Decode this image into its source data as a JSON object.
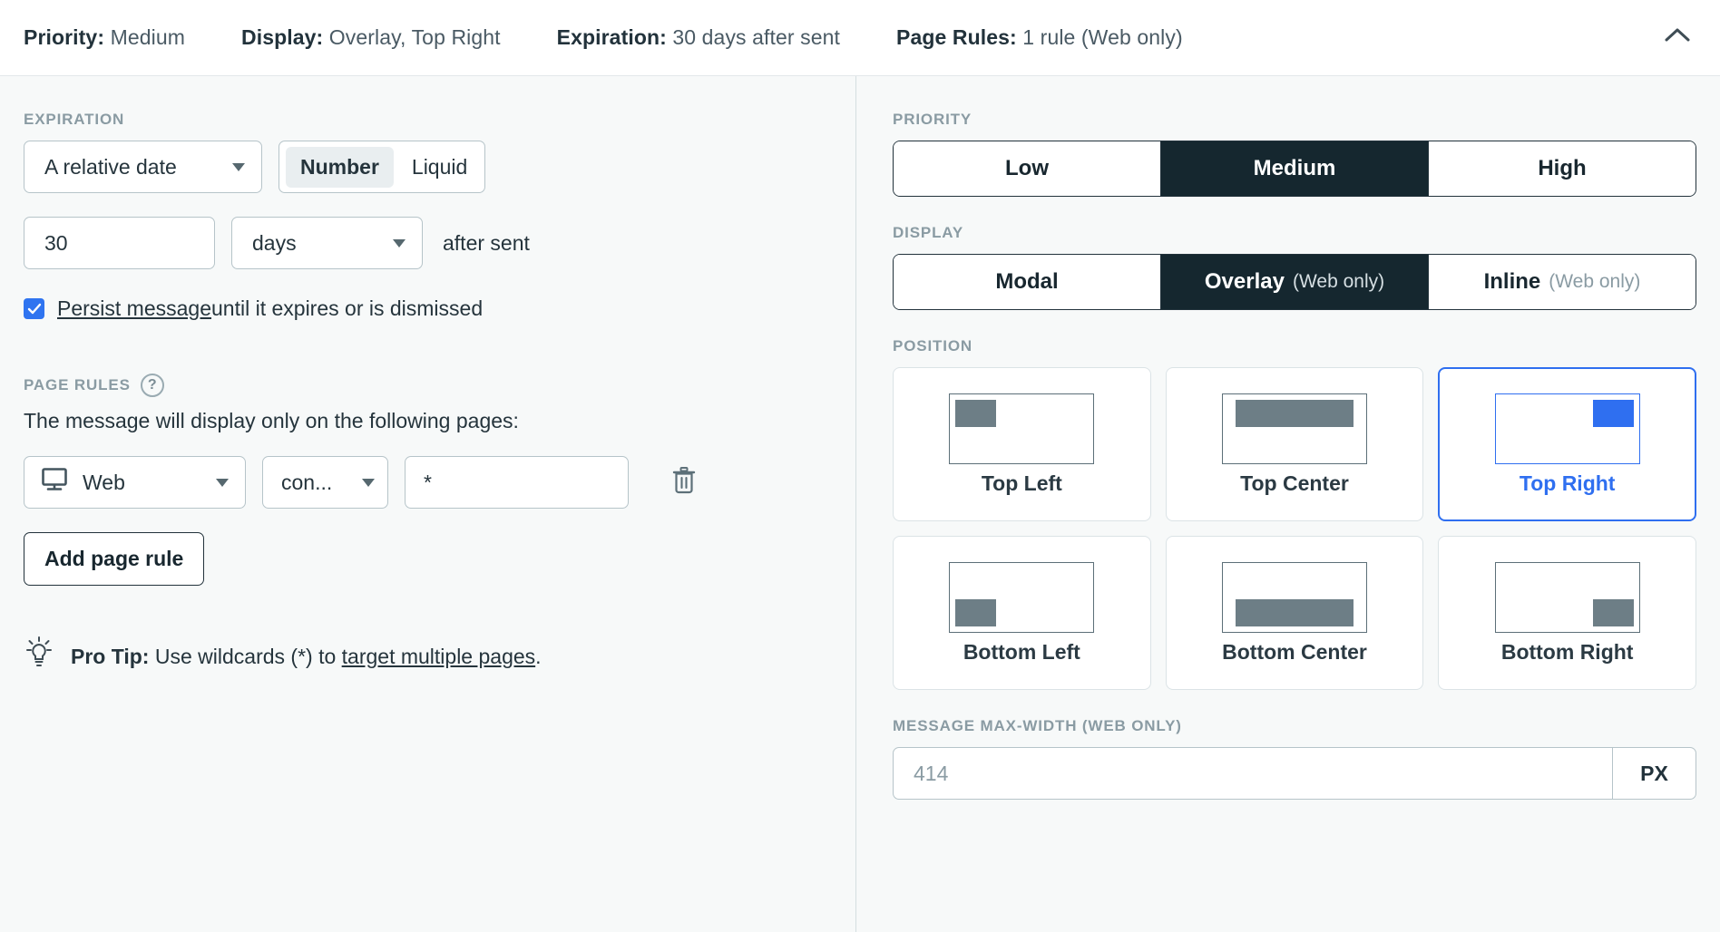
{
  "summary": {
    "items": [
      {
        "label": "Priority:",
        "value": "Medium"
      },
      {
        "label": "Display:",
        "value": "Overlay, Top Right"
      },
      {
        "label": "Expiration:",
        "value": "30 days after sent"
      },
      {
        "label": "Page Rules:",
        "value": "1 rule (Web only)"
      }
    ],
    "collapse_icon": "chevron-up-icon"
  },
  "expiration": {
    "section_label": "EXPIRATION",
    "type_select": {
      "value": "A relative date"
    },
    "mode_toggle": {
      "options": [
        "Number",
        "Liquid"
      ],
      "selected": "Number"
    },
    "amount_input": {
      "value": "30"
    },
    "unit_select": {
      "value": "days"
    },
    "suffix_text": "after sent",
    "persist": {
      "checked": true,
      "link_text": "Persist message",
      "rest_text": " until it expires or is dismissed"
    }
  },
  "page_rules": {
    "section_label": "PAGE RULES",
    "help_icon": "question-mark-icon",
    "help_glyph": "?",
    "description": "The message will display only on the following pages:",
    "rule": {
      "platform": {
        "value": "Web",
        "icon": "monitor-icon"
      },
      "operator": {
        "value": "con..."
      },
      "pattern": {
        "value": "*"
      },
      "delete_icon": "trash-icon"
    },
    "add_button": "Add page rule",
    "pro_tip": {
      "icon": "lightbulb-icon",
      "bold": "Pro Tip:",
      "text_before": " Use wildcards (*) to ",
      "link": "target multiple pages",
      "text_after": "."
    }
  },
  "priority": {
    "section_label": "PRIORITY",
    "options": [
      "Low",
      "Medium",
      "High"
    ],
    "selected": "Medium"
  },
  "display": {
    "section_label": "DISPLAY",
    "options": [
      {
        "label": "Modal",
        "sub": ""
      },
      {
        "label": "Overlay",
        "sub": "(Web only)"
      },
      {
        "label": "Inline",
        "sub": "(Web only)"
      }
    ],
    "selected": "Overlay"
  },
  "position": {
    "section_label": "POSITION",
    "selected": "Top Right",
    "cards": [
      {
        "label": "Top Left",
        "v": "top",
        "h": "left",
        "wide": false
      },
      {
        "label": "Top Center",
        "v": "top",
        "h": "center",
        "wide": true
      },
      {
        "label": "Top Right",
        "v": "top",
        "h": "right",
        "wide": false
      },
      {
        "label": "Bottom Left",
        "v": "bottom",
        "h": "left",
        "wide": false
      },
      {
        "label": "Bottom Center",
        "v": "bottom",
        "h": "center",
        "wide": true
      },
      {
        "label": "Bottom Right",
        "v": "bottom",
        "h": "right",
        "wide": false
      }
    ]
  },
  "max_width": {
    "section_label": "MESSAGE MAX-WIDTH (WEB ONLY)",
    "placeholder": "414",
    "unit": "PX"
  },
  "colors": {
    "accent_blue": "#2f6ff0",
    "dark_navy": "#15272f",
    "checkbox_blue": "#2f74f0",
    "thumb_grey": "#6d7e86",
    "page_bg": "#f7f9f9"
  }
}
